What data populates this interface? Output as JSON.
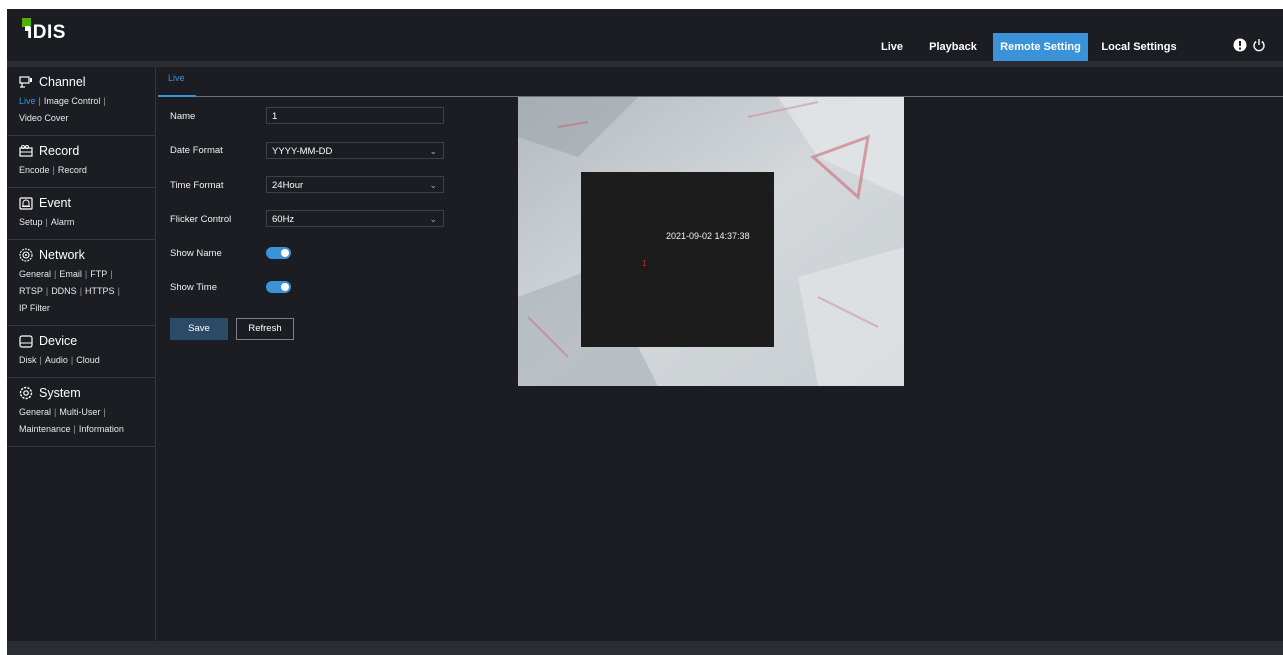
{
  "brand": {
    "logo_text": "IDIS",
    "accent": "#3a93d8"
  },
  "topnav": [
    {
      "label": "Live",
      "active": false
    },
    {
      "label": "Playback",
      "active": false
    },
    {
      "label": "Remote Setting",
      "active": true
    },
    {
      "label": "Local Settings",
      "active": false
    }
  ],
  "top_icons": [
    "alert-icon",
    "power-icon"
  ],
  "sidebar": {
    "channel": {
      "title": "Channel",
      "links": [
        "Live",
        "Image Control",
        "Video Cover"
      ]
    },
    "record": {
      "title": "Record",
      "links": [
        "Encode",
        "Record"
      ]
    },
    "event": {
      "title": "Event",
      "links": [
        "Setup",
        "Alarm"
      ]
    },
    "network": {
      "title": "Network",
      "links": [
        "General",
        "Email",
        "FTP",
        "RTSP",
        "DDNS",
        "HTTPS",
        "IP Filter"
      ]
    },
    "device": {
      "title": "Device",
      "links": [
        "Disk",
        "Audio",
        "Cloud"
      ]
    },
    "system": {
      "title": "System",
      "links": [
        "General",
        "Multi-User",
        "Maintenance",
        "Information"
      ]
    }
  },
  "main": {
    "tab": "Live",
    "form": {
      "name_label": "Name",
      "name_value": "1",
      "date_label": "Date Format",
      "date_value": "YYYY-MM-DD",
      "time_label": "Time Format",
      "time_value": "24Hour",
      "flicker_label": "Flicker Control",
      "flicker_value": "60Hz",
      "show_name_label": "Show Name",
      "show_name_on": true,
      "show_time_label": "Show Time",
      "show_time_on": true
    },
    "save_label": "Save",
    "refresh_label": "Refresh"
  },
  "preview": {
    "timestamp": "2021-09-02 14:37:38",
    "channel_name": "1"
  }
}
